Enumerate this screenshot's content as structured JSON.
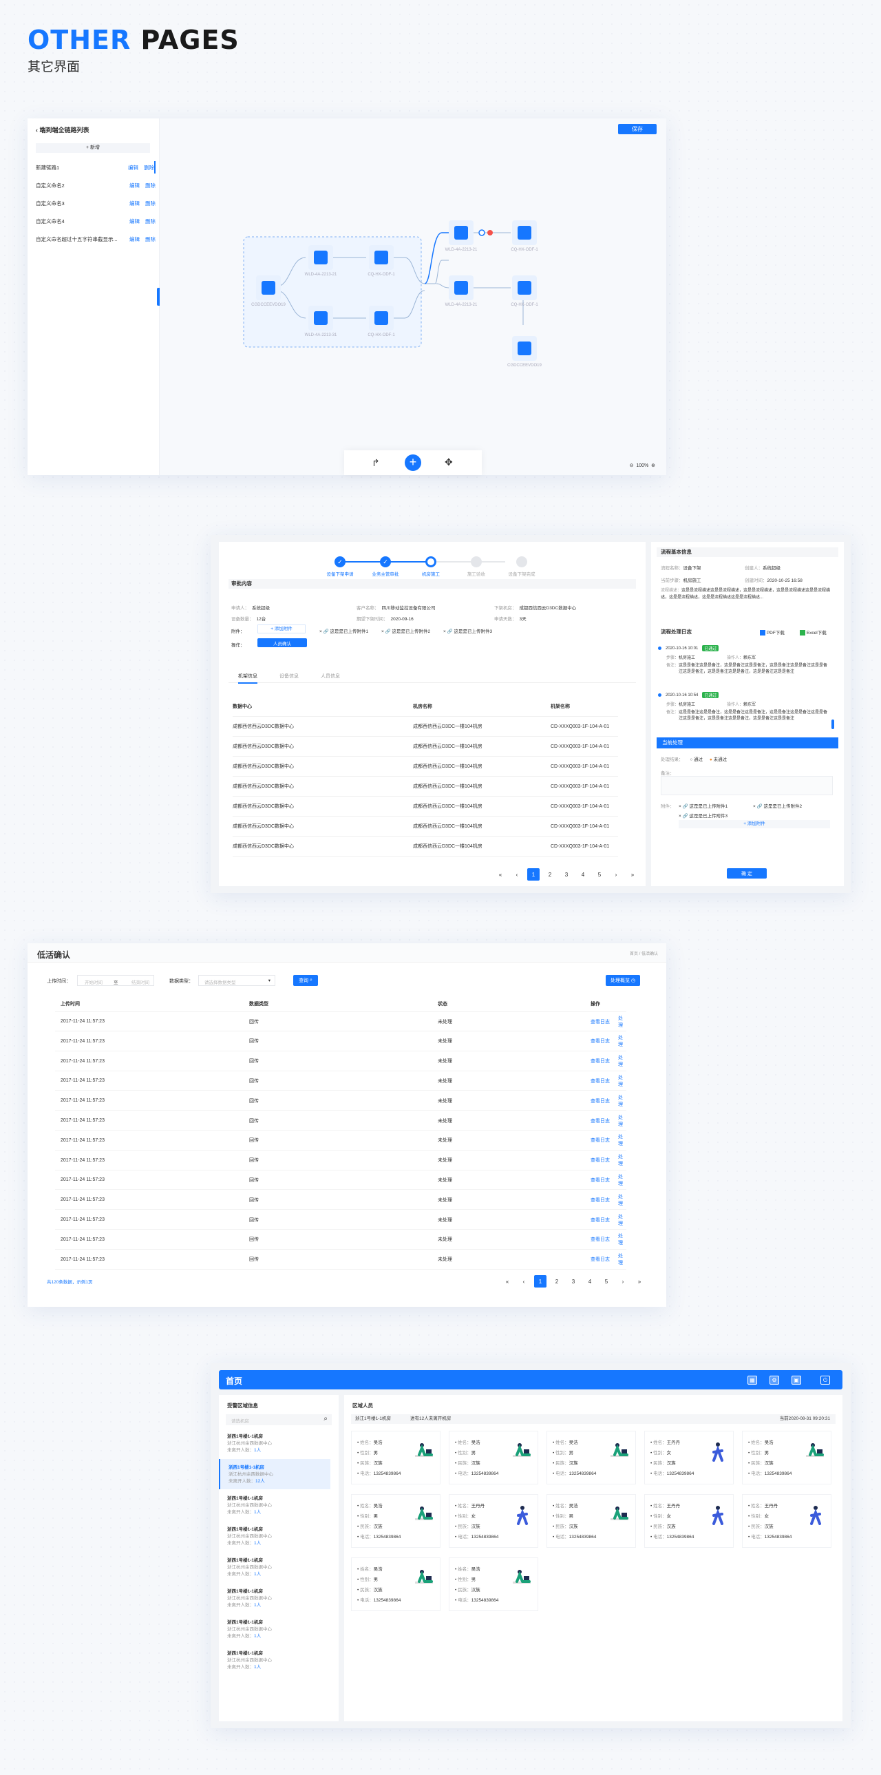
{
  "header": {
    "title_a": "OTHER",
    "title_b": " PAGES",
    "subtitle": "其它界面"
  },
  "s1": {
    "back_title": "端到端全链路列表",
    "add": "+ 新增",
    "rows": [
      {
        "label": "新建链路1",
        "edit": "编辑",
        "del": "删除"
      },
      {
        "label": "自定义命名2",
        "edit": "编辑",
        "del": "删除"
      },
      {
        "label": "自定义命名3",
        "edit": "编辑",
        "del": "删除"
      },
      {
        "label": "自定义命名4",
        "edit": "编辑",
        "del": "删除"
      },
      {
        "label": "自定义命名超过十五字符串截显示...",
        "edit": "编辑",
        "del": "删除"
      }
    ],
    "save": "保存",
    "zoom": "100%",
    "nodes": {
      "server": "CGDCCEEVDO19",
      "wld1": "WLD-4A-2213-21",
      "wld2": "WLD-4A-2213-31",
      "cq1": "CQ-HX-ODF-1",
      "cq2": "CQ-HX-ODF-1",
      "wld3": "WLD-4A-2213-21",
      "wld4": "WLD-4A-2213-21",
      "cq3": "CQ-HX-ODF-1",
      "cq4": "CQ-HX-ODF-1",
      "server2": "CGDCCEEVDO19"
    }
  },
  "s2": {
    "steps": [
      "设备下架申请",
      "业务主管审批",
      "机房施工",
      "施工验收",
      "设备下架完成"
    ],
    "audit_title": "审批内容",
    "fields": [
      {
        "k": "申请人：",
        "v": "系统超级"
      },
      {
        "k": "客户名称：",
        "v": "四川移动监控设备有限公司"
      },
      {
        "k": "下架机房：",
        "v": "成都西信西云D3DC数据中心"
      },
      {
        "k": "设备数量：",
        "v": "12台"
      },
      {
        "k": "期望下架时间：",
        "v": "2020-09-16"
      },
      {
        "k": "申请天数：",
        "v": "3天"
      }
    ],
    "attach_label": "附件：",
    "attach_btn": "+ 添加附件",
    "files": [
      "这是是已上传附件1",
      "这是是已上传附件2",
      "这是是已上传附件3"
    ],
    "op_label": "操作：",
    "op_btn": "人员确认",
    "tabs": [
      "机架信息",
      "设备信息",
      "人员信息"
    ],
    "cols": [
      "数据中心",
      "机房名称",
      "机架名称"
    ],
    "rows": [
      [
        "成都西信西云D3DC数据中心",
        "成都西信西云D3DC一楼104机房",
        "CD-XXXQ003-1F-104-A-01"
      ],
      [
        "成都西信西云D3DC数据中心",
        "成都西信西云D3DC一楼104机房",
        "CD-XXXQ003-1F-104-A-01"
      ],
      [
        "成都西信西云D3DC数据中心",
        "成都西信西云D3DC一楼104机房",
        "CD-XXXQ003-1F-104-A-01"
      ],
      [
        "成都西信西云D3DC数据中心",
        "成都西信西云D3DC一楼104机房",
        "CD-XXXQ003-1F-104-A-01"
      ],
      [
        "成都西信西云D3DC数据中心",
        "成都西信西云D3DC一楼104机房",
        "CD-XXXQ003-1F-104-A-01"
      ],
      [
        "成都西信西云D3DC数据中心",
        "成都西信西云D3DC一楼104机房",
        "CD-XXXQ003-1F-104-A-01"
      ],
      [
        "成都西信西云D3DC数据中心",
        "成都西信西云D3DC一楼104机房",
        "CD-XXXQ003-1F-104-A-01"
      ]
    ],
    "pages": [
      "«",
      "‹",
      "1",
      "2",
      "3",
      "4",
      "5",
      "›",
      "»"
    ],
    "right": {
      "basic_title": "流程基本信息",
      "basic": [
        {
          "k": "流程名称：",
          "v": "设备下架"
        },
        {
          "k": "创建人：",
          "v": "系统超级"
        },
        {
          "k": "当前步骤：",
          "v": "机房施工"
        },
        {
          "k": "创建时间：",
          "v": "2020-10-25 16:58"
        },
        {
          "k": "流程描述：",
          "v": "这是是流程描述这是是流程描述，这是是流程描述，这是是流程描述这是是流程描述，这是是流程描述，这是是流程描述这是是流程描述..."
        }
      ],
      "log_title": "流程处理日志",
      "pdf": "PDF下载",
      "excel": "Excel下载",
      "logs": [
        {
          "time": "2020-10-16 10:01",
          "badge": "已通过",
          "step": "机房施工",
          "person": "赖东军",
          "note": "这是是备注这是是备注，这是是备注这是是备注，这是是备注这是是备注这是是备注这是是备注，这是是备注这是是备注，这是是备注这是是备注"
        },
        {
          "time": "2020-10-16 10:54",
          "badge": "已通过",
          "step": "机房施工",
          "person": "赖东军",
          "note": "这是是备注这是是备注，这是是备注这是是备注，这是是备注这是是备注这是是备注这是是备注，这是是备注这是是备注，这是是备注这是是备注"
        }
      ],
      "step_k": "步骤：",
      "person_k": "操作人：",
      "note_k": "备注：",
      "cur_title": "当前处理",
      "result_k": "处理结果：",
      "pass": "通过",
      "reject": "未通过",
      "remark_k": "备注：",
      "attach_k": "附件：",
      "files": [
        "这是是已上传附件1",
        "这是是已上传附件2",
        "这是是已上传附件3"
      ],
      "add_attach": "+ 添加附件",
      "confirm": "确 定"
    }
  },
  "s3": {
    "title": "低活确认",
    "crumb": "首页 / 低活确认",
    "upload_time": "上传时间：",
    "start": "开始时间",
    "to": "至",
    "end": "结束时间",
    "dtype": "数据类型：",
    "dtype_ph": "请选择数据类型",
    "query": "查询",
    "summary": "处理概览",
    "cols": [
      "上传时间",
      "数据类型",
      "状态",
      "操作"
    ],
    "row": {
      "time": "2017-11-24 11:57:23",
      "type": "回传",
      "status": "未处理",
      "view": "查看日志",
      "handle": "处理"
    },
    "row_count": 13,
    "footer": "共120条数据，示例1页",
    "pages": [
      "«",
      "‹",
      "1",
      "2",
      "3",
      "4",
      "5",
      "›",
      "»"
    ]
  },
  "s4": {
    "title": "首页",
    "left_title": "受警区域信息",
    "search_ph": "请选机房",
    "areas": [
      {
        "name": "浙西1号楼1-1机房",
        "addr": "浙江杭州余西数据中心",
        "count_k": "未离开人数：",
        "count": "1人"
      },
      {
        "name": "浙西1号楼1-1机房",
        "addr": "浙江杭州余西数据中心",
        "count_k": "未离开人数：",
        "count": "12人"
      },
      {
        "name": "浙西1号楼1-1机房",
        "addr": "浙江杭州余西数据中心",
        "count_k": "未离开人数：",
        "count": "1人"
      },
      {
        "name": "浙西1号楼1-1机房",
        "addr": "浙江杭州余西数据中心",
        "count_k": "未离开人数：",
        "count": "1人"
      },
      {
        "name": "浙西1号楼1-1机房",
        "addr": "浙江杭州余西数据中心",
        "count_k": "未离开人数：",
        "count": "1人"
      },
      {
        "name": "浙西1号楼1-1机房",
        "addr": "浙江杭州余西数据中心",
        "count_k": "未离开人数：",
        "count": "1人"
      },
      {
        "name": "浙西1号楼1-1机房",
        "addr": "浙江杭州余西数据中心",
        "count_k": "未离开人数：",
        "count": "1人"
      },
      {
        "name": "浙西1号楼1-1机房",
        "addr": "浙江杭州余西数据中心",
        "count_k": "未离开人数：",
        "count": "1人"
      }
    ],
    "right_title": "区域人员",
    "loc": "浙江1号楼1-1机房",
    "summary": "进有12人未离开机房",
    "now": "当前2020-08-31 09:20:31",
    "k_name": "姓名：",
    "k_sex": "性别：",
    "k_dept": "民族：",
    "k_phone": "电话：",
    "people": [
      {
        "name": "吴浩",
        "sex": "男",
        "dept": "汉族",
        "phone": "13254839864",
        "fig": "sit"
      },
      {
        "name": "吴浩",
        "sex": "男",
        "dept": "汉族",
        "phone": "13254839864",
        "fig": "sit"
      },
      {
        "name": "吴浩",
        "sex": "男",
        "dept": "汉族",
        "phone": "13254839864",
        "fig": "sit"
      },
      {
        "name": "王丹丹",
        "sex": "女",
        "dept": "汉族",
        "phone": "13254839864",
        "fig": "walk"
      },
      {
        "name": "吴浩",
        "sex": "男",
        "dept": "汉族",
        "phone": "13254839864",
        "fig": "sit"
      },
      {
        "name": "吴浩",
        "sex": "男",
        "dept": "汉族",
        "phone": "13254839864",
        "fig": "sit"
      },
      {
        "name": "王丹丹",
        "sex": "女",
        "dept": "汉族",
        "phone": "13254839864",
        "fig": "walk"
      },
      {
        "name": "吴浩",
        "sex": "男",
        "dept": "汉族",
        "phone": "13254839864",
        "fig": "sit"
      },
      {
        "name": "王丹丹",
        "sex": "女",
        "dept": "汉族",
        "phone": "13254839864",
        "fig": "walk"
      },
      {
        "name": "王丹丹",
        "sex": "女",
        "dept": "汉族",
        "phone": "13254839864",
        "fig": "walk"
      },
      {
        "name": "吴浩",
        "sex": "男",
        "dept": "汉族",
        "phone": "13254839864",
        "fig": "sit"
      },
      {
        "name": "吴浩",
        "sex": "男",
        "dept": "汉族",
        "phone": "13254839864",
        "fig": "sit"
      }
    ],
    "accent": "#1677ff"
  }
}
